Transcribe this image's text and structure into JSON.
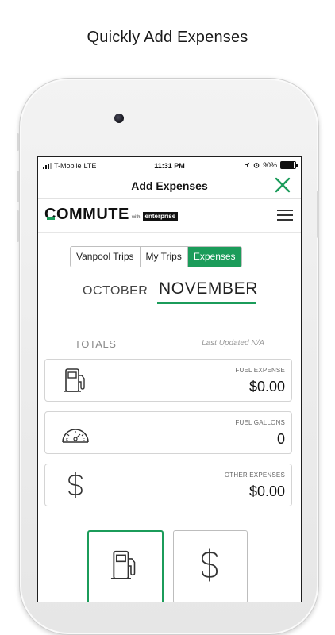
{
  "caption": "Quickly Add Expenses",
  "status_bar": {
    "carrier": "T-Mobile",
    "network": "LTE",
    "time": "11:31 PM",
    "battery": "90%",
    "battery_level": 0.9
  },
  "nav": {
    "title": "Add Expenses",
    "close_icon": "close-icon"
  },
  "brand": {
    "logo_text": "COMMUTE",
    "logo_with": "with",
    "logo_partner": "enterprise"
  },
  "tabs": [
    {
      "label": "Vanpool Trips",
      "active": false
    },
    {
      "label": "My Trips",
      "active": false
    },
    {
      "label": "Expenses",
      "active": true
    }
  ],
  "months": {
    "previous": "OCTOBER",
    "current": "NOVEMBER"
  },
  "totals": {
    "label": "TOTALS",
    "last_updated": "Last Updated N/A"
  },
  "cards": [
    {
      "label": "FUEL EXPENSE",
      "value": "$0.00",
      "icon": "fuel-pump-icon"
    },
    {
      "label": "FUEL GALLONS",
      "value": "0",
      "icon": "fuel-gauge-icon"
    },
    {
      "label": "OTHER EXPENSES",
      "value": "$0.00",
      "icon": "dollar-icon"
    }
  ],
  "colors": {
    "accent": "#1b9c5a",
    "text": "#222222",
    "muted": "#8a8a8a"
  }
}
